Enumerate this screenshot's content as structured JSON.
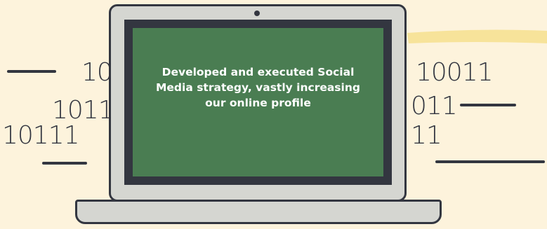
{
  "binary_left": [
    "10",
    "1011",
    "10111"
  ],
  "binary_right": [
    "10011",
    "011",
    "11"
  ],
  "screen": {
    "message": "Developed and executed Social Media strategy, vastly increasing our online profile"
  },
  "colors": {
    "background": "#fdf3dc",
    "accent_stroke": "#f7e39a",
    "dark": "#333640",
    "screen": "#4a7d52",
    "laptop_body": "#d5d6d1"
  }
}
